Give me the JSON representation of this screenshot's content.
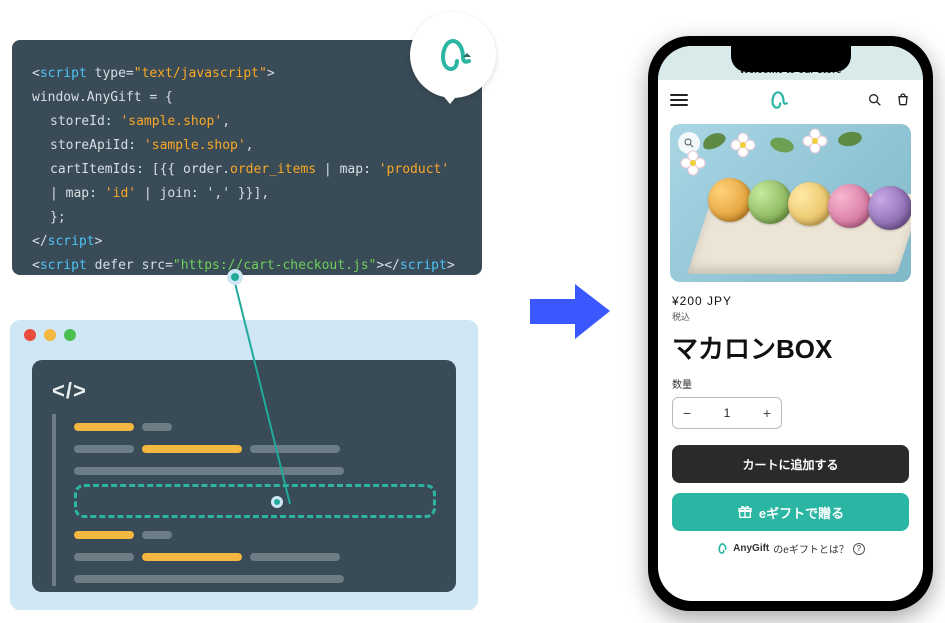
{
  "code": {
    "l1a": "<",
    "l1b": "script",
    "l1c": " type=",
    "l1d": "\"text/javascript\"",
    "l1e": ">",
    "l2": "window.AnyGift = {",
    "l3a": "storeId: ",
    "l3b": "'sample.shop'",
    "l3c": ",",
    "l4a": "storeApiId: ",
    "l4b": "'sample.shop'",
    "l4c": ",",
    "l5a": "cartItemIds: [{{ order.",
    "l5b": "order_items",
    "l5c": " | map: ",
    "l5d": "'product'",
    "l5e": " | map: ",
    "l5f": "'id'",
    "l5g": " | join: ',' }}],",
    "l6": "};",
    "l7a": "</",
    "l7b": "script",
    "l7c": ">",
    "l8a": "<",
    "l8b": "script",
    "l8c": " defer src=",
    "l8d": "\"https://cart-checkout.js\"",
    "l8e": "></",
    "l8f": "script",
    "l8g": ">"
  },
  "editor": {
    "code_icon": "</>"
  },
  "phone": {
    "banner": "Welcome to our store",
    "price": "¥200 JPY",
    "tax": "税込",
    "product_name": "マカロンBOX",
    "qty_label": "数量",
    "qty_value": "1",
    "add_to_cart": "カートに追加する",
    "gift_button": "eギフトで贈る",
    "helper_brand": "AnyGift",
    "helper_text": " のeギフトとは？",
    "helper_icon": "?"
  }
}
